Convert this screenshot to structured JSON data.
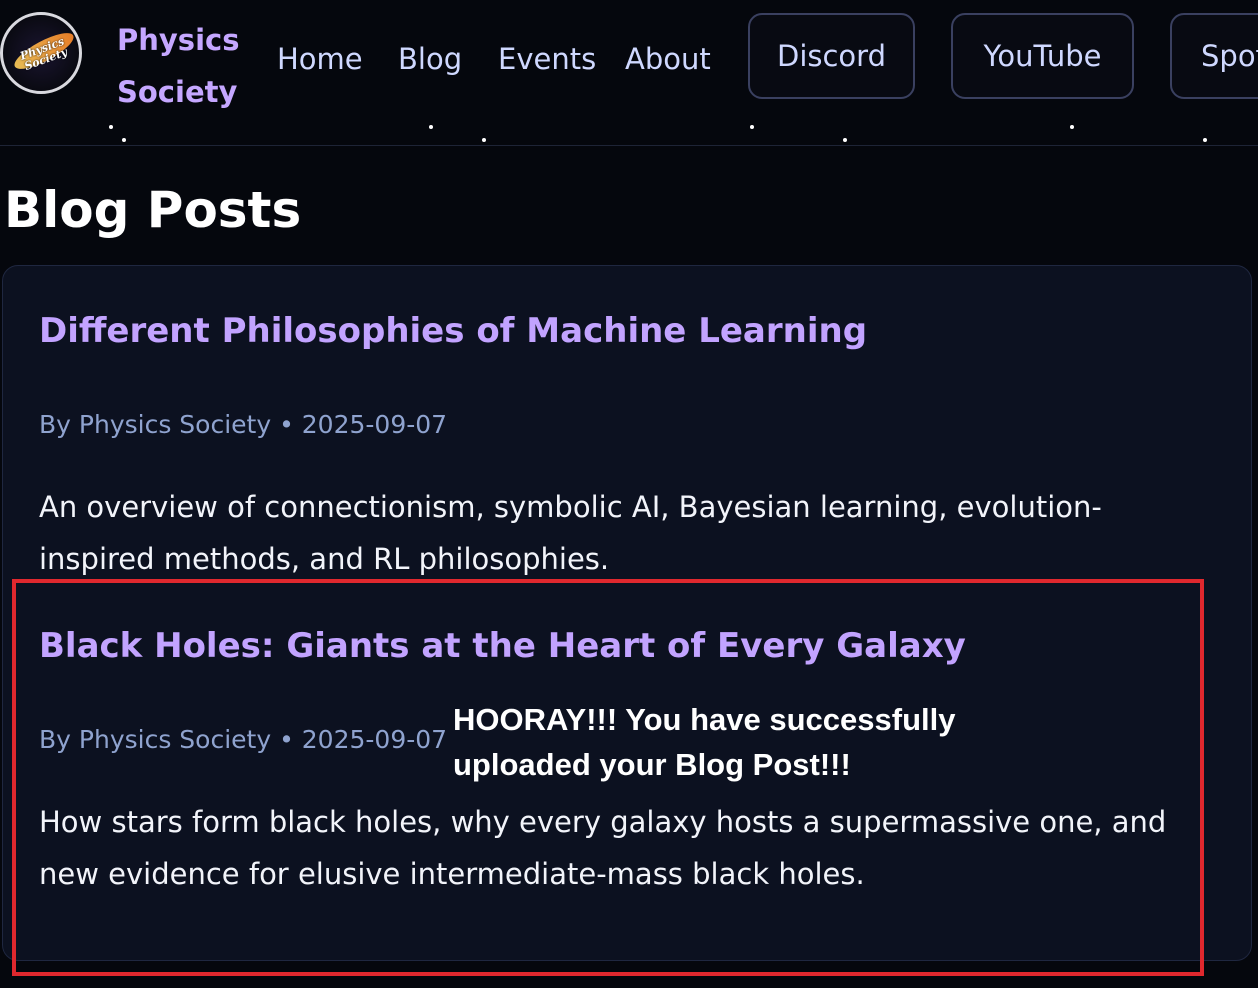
{
  "header": {
    "logo_text": "Physics Society",
    "brand_line1": "Physics",
    "brand_line2": "Society",
    "nav_links": [
      "Home",
      "Blog",
      "Events",
      "About"
    ],
    "nav_buttons": [
      "Discord",
      "YouTube",
      "Spot"
    ]
  },
  "main": {
    "page_title": "Blog Posts",
    "posts": [
      {
        "title": "Different Philosophies of Machine Learning",
        "meta": "By Physics Society • 2025-09-07",
        "excerpt": "An overview of connectionism, symbolic AI, Bayesian learning, evolution-inspired methods, and RL philosophies."
      },
      {
        "title": "Black Holes: Giants at the Heart of Every Galaxy",
        "meta": "By Physics Society • 2025-09-07",
        "excerpt": "How stars form black holes, why every galaxy hosts a supermassive one, and new evidence for elusive intermediate-mass black holes."
      }
    ]
  },
  "overlay": {
    "message_line1": "HOORAY!!! You have successfully",
    "message_line2": "uploaded your Blog Post!!!"
  },
  "colors": {
    "background": "#05070d",
    "card": "#0c1120",
    "brand": "#c5a7ff",
    "post_title": "#c2a3ff",
    "highlight": "#e0282e"
  }
}
